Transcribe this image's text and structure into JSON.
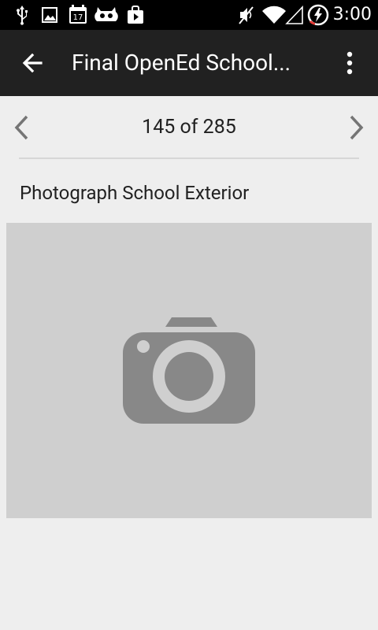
{
  "status_bar": {
    "time": "3:00",
    "icons": [
      "usb-icon",
      "image-icon",
      "calendar-icon",
      "cyanogenmod-icon",
      "play-store-icon",
      "mute-icon",
      "wifi-icon",
      "no-signal-icon",
      "battery-charging-icon"
    ],
    "calendar_day": "17"
  },
  "app_bar": {
    "title": "Final OpenEd School...",
    "back_icon": "arrow-back-icon",
    "overflow_icon": "more-vert-icon"
  },
  "pager": {
    "count": "145 of 285",
    "prev_icon": "chevron-left-icon",
    "next_icon": "chevron-right-icon"
  },
  "question": {
    "label": "Photograph School Exterior"
  },
  "photo": {
    "icon": "camera-icon"
  },
  "colors": {
    "status_bar_bg": "#000000",
    "app_bar_bg": "#212121",
    "page_bg": "#eeeeee",
    "placeholder_bg": "#cfcfcf",
    "camera_icon": "#888888"
  }
}
